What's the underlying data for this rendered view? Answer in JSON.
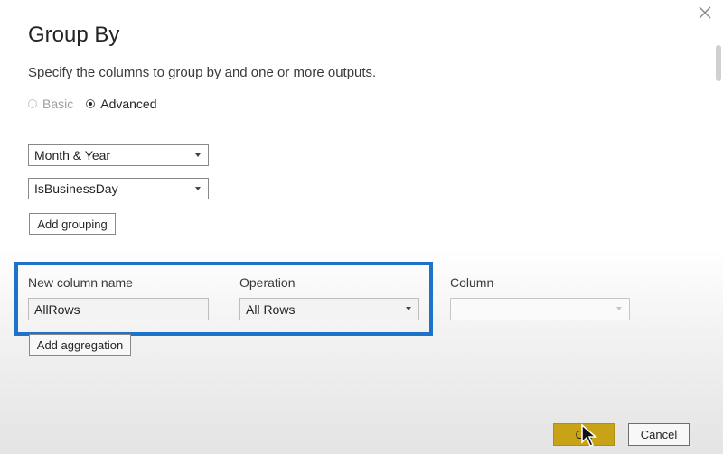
{
  "dialog": {
    "title": "Group By",
    "subtitle": "Specify the columns to group by and one or more outputs.",
    "close_icon": "close-icon"
  },
  "mode": {
    "options": [
      {
        "label": "Basic",
        "checked": false,
        "disabled": true
      },
      {
        "label": "Advanced",
        "checked": true,
        "disabled": false
      }
    ]
  },
  "grouping": {
    "columns": [
      "Month & Year",
      "IsBusinessDay"
    ],
    "add_label": "Add grouping"
  },
  "aggregation": {
    "new_column_label": "New column name",
    "operation_label": "Operation",
    "column_label": "Column",
    "new_column_value": "AllRows",
    "operation_value": "All Rows",
    "column_value": "",
    "add_label": "Add aggregation",
    "highlight_color": "#1e73c8"
  },
  "footer": {
    "ok_label": "OK",
    "cancel_label": "Cancel",
    "ok_color": "#c9a317"
  }
}
